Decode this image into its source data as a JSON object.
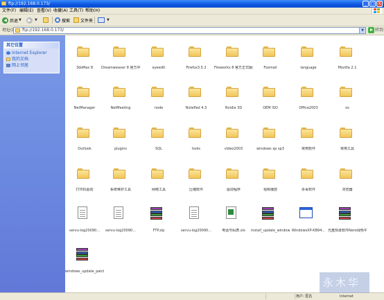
{
  "window": {
    "title": "ftp://192.168.0.173/",
    "minimize": "_",
    "maximize": "□",
    "close": "X"
  },
  "menu": [
    "文件(F)",
    "编辑(E)",
    "查看(V)",
    "收藏(A)",
    "工具(T)",
    "帮助(H)"
  ],
  "toolbar": {
    "back": "后退",
    "search": "搜索",
    "folders": "文件夹"
  },
  "address": {
    "label": "地址(D)",
    "value": "ftp://192.168.0.173/",
    "go": "转到"
  },
  "taskpane": {
    "title": "其它位置",
    "links": [
      "Internet Explorer",
      "我的文档",
      "网上邻居"
    ]
  },
  "files": [
    {
      "name": "3dsMax 8",
      "type": "folder"
    },
    {
      "name": "Dreamweaver 8 官方中文版及注册",
      "type": "folder"
    },
    {
      "name": "eyeedit",
      "type": "folder"
    },
    {
      "name": "Firefox3.5.2",
      "type": "folder"
    },
    {
      "name": "Fireworks 8 官方正式版和注册",
      "type": "folder"
    },
    {
      "name": "Foxmail",
      "type": "folder"
    },
    {
      "name": "language",
      "type": "folder"
    },
    {
      "name": "Mozilla 2.1",
      "type": "folder"
    },
    {
      "name": "NetManager",
      "type": "folder"
    },
    {
      "name": "NetMeeting",
      "type": "folder"
    },
    {
      "name": "node",
      "type": "folder"
    },
    {
      "name": "NotePad 4.3",
      "type": "folder"
    },
    {
      "name": "Nvidia 3D",
      "type": "folder"
    },
    {
      "name": "OEM ISO",
      "type": "folder"
    },
    {
      "name": "Office2003",
      "type": "folder"
    },
    {
      "name": "os",
      "type": "folder"
    },
    {
      "name": "Outlook",
      "type": "folder"
    },
    {
      "name": "plugins",
      "type": "folder"
    },
    {
      "name": "SQL",
      "type": "folder"
    },
    {
      "name": "tools",
      "type": "folder"
    },
    {
      "name": "video2003",
      "type": "folder"
    },
    {
      "name": "windows xp sp3",
      "type": "folder"
    },
    {
      "name": "常用软件",
      "type": "folder"
    },
    {
      "name": "常用工具",
      "type": "folder"
    },
    {
      "name": "打印机驱动",
      "type": "folder"
    },
    {
      "name": "系统维护工具",
      "type": "folder"
    },
    {
      "name": "网络工具",
      "type": "folder"
    },
    {
      "name": "压缩软件",
      "type": "folder"
    },
    {
      "name": "驱动程序",
      "type": "folder"
    },
    {
      "name": "视频播放",
      "type": "folder"
    },
    {
      "name": "杀毒软件",
      "type": "folder"
    },
    {
      "name": "浏览器",
      "type": "folder"
    },
    {
      "name": "servu-log20090...",
      "type": "txt"
    },
    {
      "name": "servu-log20090...",
      "type": "txt"
    },
    {
      "name": "FTP.zip",
      "type": "rar"
    },
    {
      "name": "servu-log20090...",
      "type": "txt"
    },
    {
      "name": "电话号码表.xls",
      "type": "xls"
    },
    {
      "name": "install_update_windows...",
      "type": "rar"
    },
    {
      "name": "WindowsXP-KB94...",
      "type": "exe"
    },
    {
      "name": "光盘刻录软件Nero绿色中文版.rar",
      "type": "rar"
    },
    {
      "name": "windows_update_patch...",
      "type": "rar"
    }
  ],
  "status": {
    "zone": "用户: 匿名",
    "location": "Internet"
  },
  "watermark": "永木华"
}
